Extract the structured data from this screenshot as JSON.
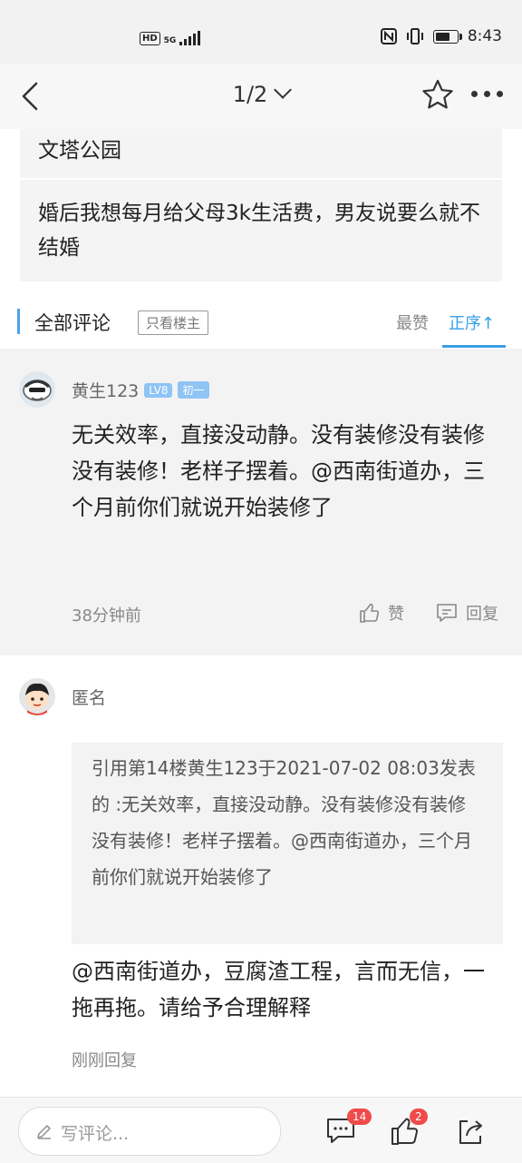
{
  "status_bar": {
    "network_hd": "HD",
    "network_5g": "5G",
    "time": "8:43"
  },
  "nav": {
    "page_indicator": "1/2"
  },
  "post": {
    "location": "文塔公园",
    "title": "婚后我想每月给父母3k生活费，男友说要么就不结婚"
  },
  "comments_header": {
    "all_label": "全部评论",
    "op_only_label": "只看楼主",
    "sort_best": "最赞",
    "sort_order": "正序↑"
  },
  "comments": [
    {
      "username": "黄生123",
      "level": "LV8",
      "rank": "初一",
      "text": "无关效率，直接没动静。没有装修没有装修没有装修！老样子摆着。@西南街道办，三个月前你们就说开始装修了",
      "time": "38分钟前",
      "like_label": "赞",
      "reply_label": "回复"
    },
    {
      "username": "匿名",
      "quote": "引用第14楼黄生123于2021-07-02 08:03发表的 :无关效率，直接没动静。没有装修没有装修没有装修！老样子摆着。@西南街道办，三个月前你们就说开始装修了",
      "text": "@西南街道办，豆腐渣工程，言而无信，一拖再拖。请给予合理解释",
      "time": "刚刚回复"
    }
  ],
  "bottom_bar": {
    "input_placeholder": "写评论...",
    "comment_count": "14",
    "like_count": "2"
  },
  "colors": {
    "accent": "#3a9fe6",
    "badge": "#f04a4a"
  }
}
